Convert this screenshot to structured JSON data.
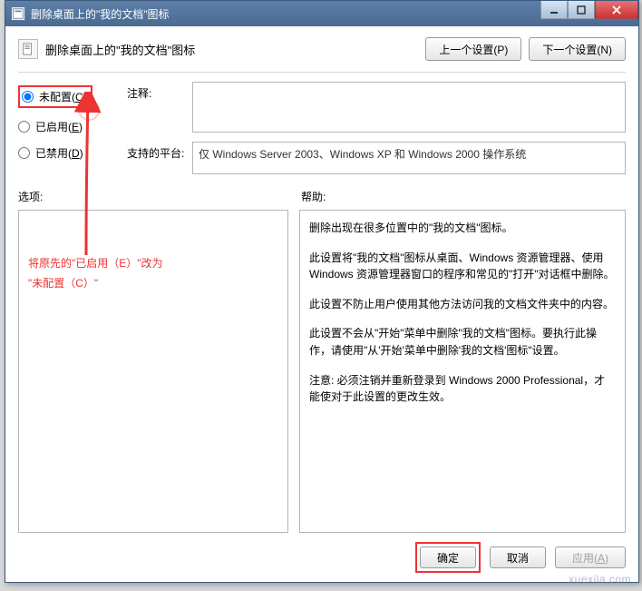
{
  "window": {
    "title": "删除桌面上的\"我的文档\"图标"
  },
  "header": {
    "label": "删除桌面上的\"我的文档\"图标",
    "prev": "上一个设置(P)",
    "next": "下一个设置(N)"
  },
  "radios": {
    "not_configured": "未配置(",
    "not_configured_key": "C",
    "not_configured_suffix": ")",
    "enabled": "已启用(",
    "enabled_key": "E",
    "enabled_suffix": ")",
    "disabled": "已禁用(",
    "disabled_key": "D",
    "disabled_suffix": ")"
  },
  "fields": {
    "comment_label": "注释:",
    "platform_label": "支持的平台:",
    "platform_value": "仅 Windows Server 2003、Windows XP 和 Windows 2000 操作系统"
  },
  "section": {
    "options": "选项:",
    "help": "帮助:"
  },
  "annotation": {
    "line1": "将原先的\"已启用（E）\"改为",
    "line2": "\"未配置（C）\""
  },
  "help": {
    "p1": "删除出现在很多位置中的\"我的文档\"图标。",
    "p2": "此设置将\"我的文档\"图标从桌面、Windows 资源管理器、使用 Windows 资源管理器窗口的程序和常见的\"打开\"对话框中删除。",
    "p3": "此设置不防止用户使用其他方法访问我的文档文件夹中的内容。",
    "p4": "此设置不会从\"开始\"菜单中删除\"我的文档\"图标。要执行此操作，请使用\"从'开始'菜单中删除'我的文档'图标\"设置。",
    "p5": "注意: 必须注销并重新登录到 Windows 2000 Professional，才能使对于此设置的更改生效。"
  },
  "footer": {
    "ok": "确定",
    "cancel": "取消",
    "apply": "应用(",
    "apply_key": "A",
    "apply_suffix": ")"
  },
  "watermark": "xuexila.com"
}
